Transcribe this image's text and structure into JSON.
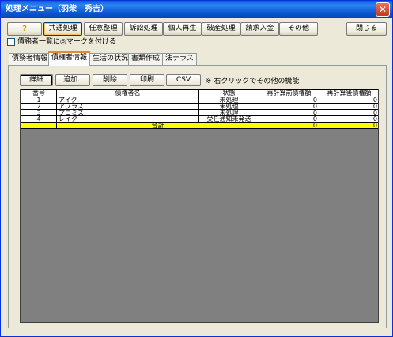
{
  "window": {
    "title": "処理メニュー（羽柴　秀吉）",
    "close_symbol": "✕"
  },
  "toolbar": {
    "help_symbol": "?",
    "buttons": [
      "共通処理",
      "任意整理",
      "訴訟処理",
      "個人再生",
      "破産処理",
      "請求入金",
      "その他"
    ],
    "close_label": "閉じる"
  },
  "checkbox": {
    "label": "債務者一覧に◎マークを付ける",
    "checked": false
  },
  "tabs": [
    "債務者情報",
    "債権者情報",
    "生活の状況",
    "書類作成",
    "法テラス"
  ],
  "selected_tab": "債権者情報",
  "panel": {
    "buttons": [
      "詳細",
      "追加..",
      "削除",
      "印刷",
      "CSV"
    ],
    "note": "※ 右クリックでその他の機能"
  },
  "grid": {
    "columns": [
      "番号",
      "債権者名",
      "状態",
      "再計算前債権額",
      "再計算後債権額"
    ],
    "rows": [
      {
        "no": "1",
        "name": "アイク",
        "status": "未処理",
        "before": "0",
        "after": "0"
      },
      {
        "no": "2",
        "name": "アプラス",
        "status": "未処理",
        "before": "0",
        "after": "0"
      },
      {
        "no": "3",
        "name": "プロミス",
        "status": "未処理",
        "before": "0",
        "after": "0"
      },
      {
        "no": "4",
        "name": "レイク",
        "status": "受任通知未発送",
        "before": "0",
        "after": "0"
      }
    ],
    "total": {
      "label": "合計",
      "before": "0",
      "after": "0"
    }
  },
  "colors": {
    "total_row": "#ffff00",
    "grid_empty": "#808080",
    "titlebar": "#0a5fd8"
  }
}
